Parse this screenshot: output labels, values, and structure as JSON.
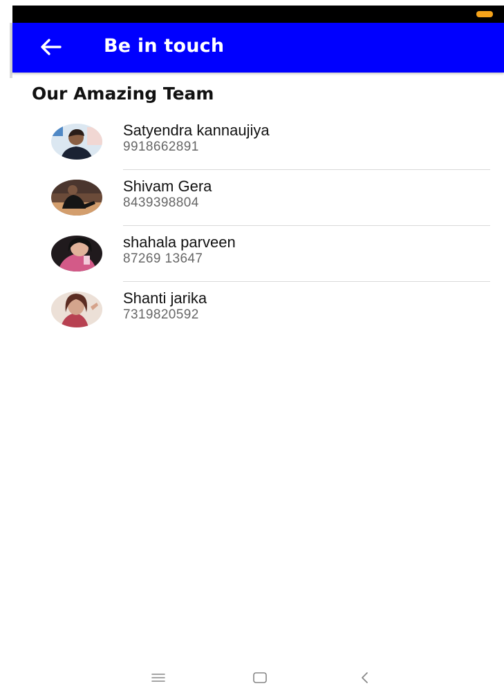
{
  "header": {
    "title": "Be in touch",
    "back_icon": "arrow-left-icon",
    "background_color": "#0000ff"
  },
  "section": {
    "title": "Our Amazing Team"
  },
  "team": [
    {
      "name": "Satyendra kannaujiya",
      "phone": "9918662891",
      "avatar_icon": "profile-photo"
    },
    {
      "name": "Shivam Gera",
      "phone": "8439398804",
      "avatar_icon": "profile-photo"
    },
    {
      "name": "shahala parveen",
      "phone": "87269 13647",
      "avatar_icon": "profile-photo"
    },
    {
      "name": "Shanti jarika",
      "phone": "7319820592",
      "avatar_icon": "profile-photo"
    }
  ],
  "system_nav": {
    "menu_icon": "menu-icon",
    "home_icon": "home-square-icon",
    "back_icon": "chevron-left-icon"
  },
  "colors": {
    "status_bar": "#000000",
    "battery": "#f5a31a",
    "text_primary": "#111111",
    "text_secondary": "#666666"
  }
}
